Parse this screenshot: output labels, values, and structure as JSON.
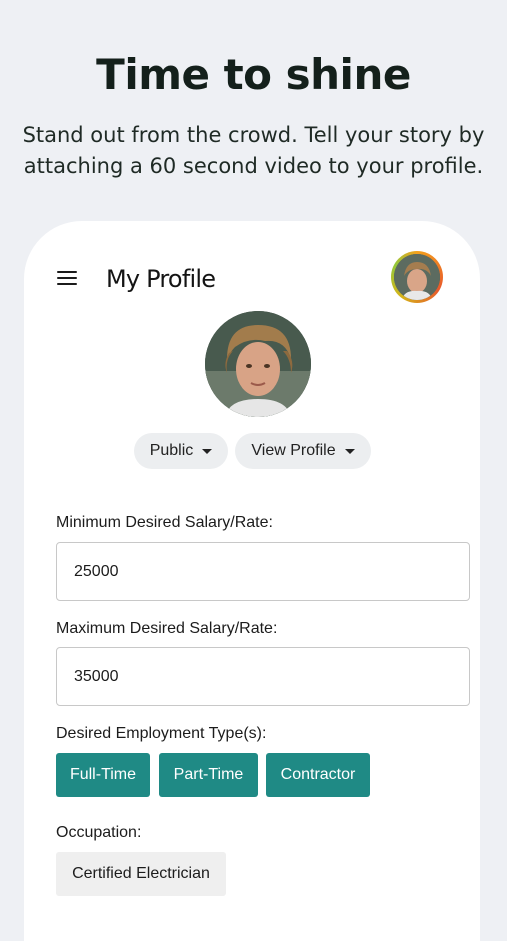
{
  "promo": {
    "headline": "Time to shine",
    "subhead": "Stand out from the crowd. Tell your story by attaching a 60 second video to your profile."
  },
  "header": {
    "title": "My Profile",
    "menu_icon": "hamburger-menu-icon",
    "avatar_icon": "user-avatar"
  },
  "profile": {
    "visibility_label": "Public",
    "view_profile_label": "View Profile"
  },
  "form": {
    "min_salary": {
      "label": "Minimum Desired Salary/Rate:",
      "value": "25000"
    },
    "max_salary": {
      "label": "Maximum Desired Salary/Rate:",
      "value": "35000"
    },
    "employment": {
      "label": "Desired Employment Type(s):",
      "options": [
        "Full-Time",
        "Part-Time",
        "Contractor"
      ]
    },
    "occupation": {
      "label": "Occupation:",
      "value": "Certified Electrician"
    }
  },
  "colors": {
    "background": "#eef0f4",
    "accent_teal": "#1f8a85",
    "avatar_ring": "#f4a11c"
  }
}
